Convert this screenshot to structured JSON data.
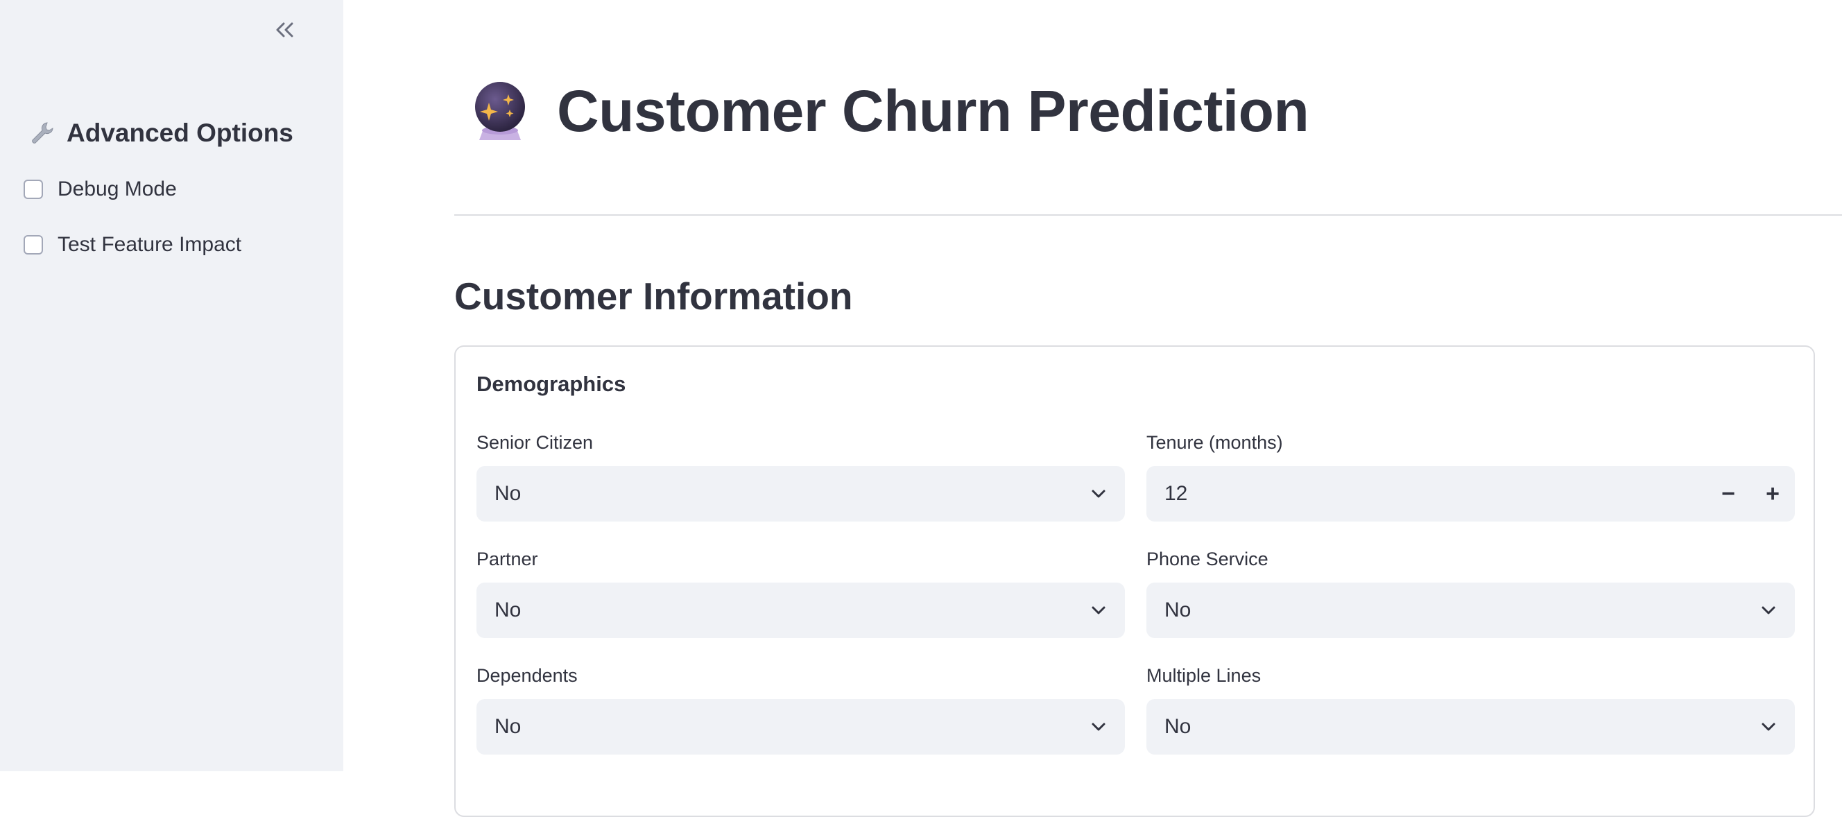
{
  "sidebar": {
    "collapse_icon": "double-chevron-left-icon",
    "header_icon": "wrench-icon",
    "header": "Advanced Options",
    "options": [
      {
        "label": "Debug Mode",
        "checked": false
      },
      {
        "label": "Test Feature Impact",
        "checked": false
      }
    ]
  },
  "main": {
    "title_icon": "crystal-ball-icon",
    "title": "Customer Churn Prediction",
    "section_title": "Customer Information",
    "card": {
      "title": "Demographics",
      "fields": {
        "senior_citizen": {
          "label": "Senior Citizen",
          "value": "No"
        },
        "tenure": {
          "label": "Tenure (months)",
          "value": "12",
          "minus": "−",
          "plus": "+"
        },
        "partner": {
          "label": "Partner",
          "value": "No"
        },
        "phone_service": {
          "label": "Phone Service",
          "value": "No"
        },
        "dependents": {
          "label": "Dependents",
          "value": "No"
        },
        "multiple_lines": {
          "label": "Multiple Lines",
          "value": "No"
        }
      }
    }
  },
  "colors": {
    "sidebar_bg": "#f0f2f6",
    "text": "#31333f",
    "control_bg": "#f0f2f6",
    "border": "#dcdde1"
  }
}
